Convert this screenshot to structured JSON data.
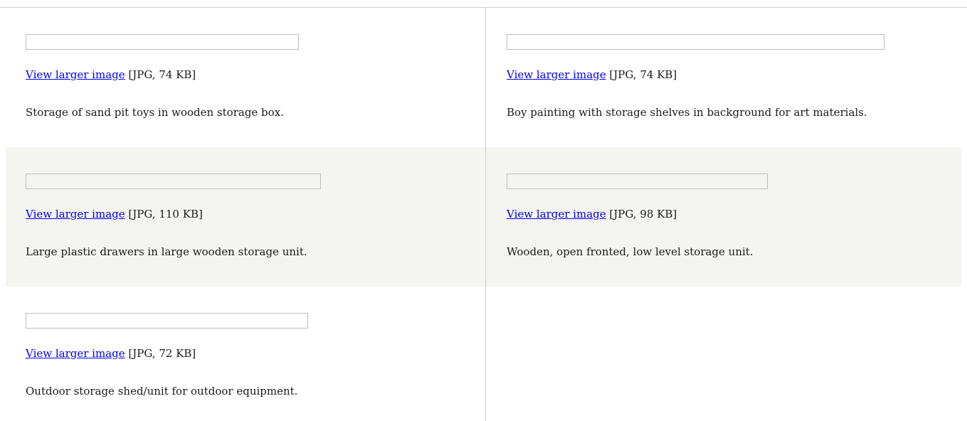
{
  "items": [
    {
      "link": "View larger image",
      "meta": "[JPG, 74 KB]",
      "description": "Storage of sand pit toys in wooden storage box."
    },
    {
      "link": "View larger image",
      "meta": "[JPG, 74 KB]",
      "description": "Boy painting with storage shelves in background for art materials."
    },
    {
      "link": "View larger image",
      "meta": "[JPG, 110 KB]",
      "description": "Large plastic drawers in large wooden storage unit."
    },
    {
      "link": "View larger image",
      "meta": "[JPG, 98 KB]",
      "description": "Wooden, open fronted, low level storage unit."
    },
    {
      "link": "View larger image",
      "meta": "[JPG, 72 KB]",
      "description": "Outdoor storage shed/unit for outdoor equipment."
    }
  ],
  "colors": {
    "link": "#0000ee",
    "shaded_row": "#f4f4f0",
    "divider": "#cfcfcf"
  }
}
